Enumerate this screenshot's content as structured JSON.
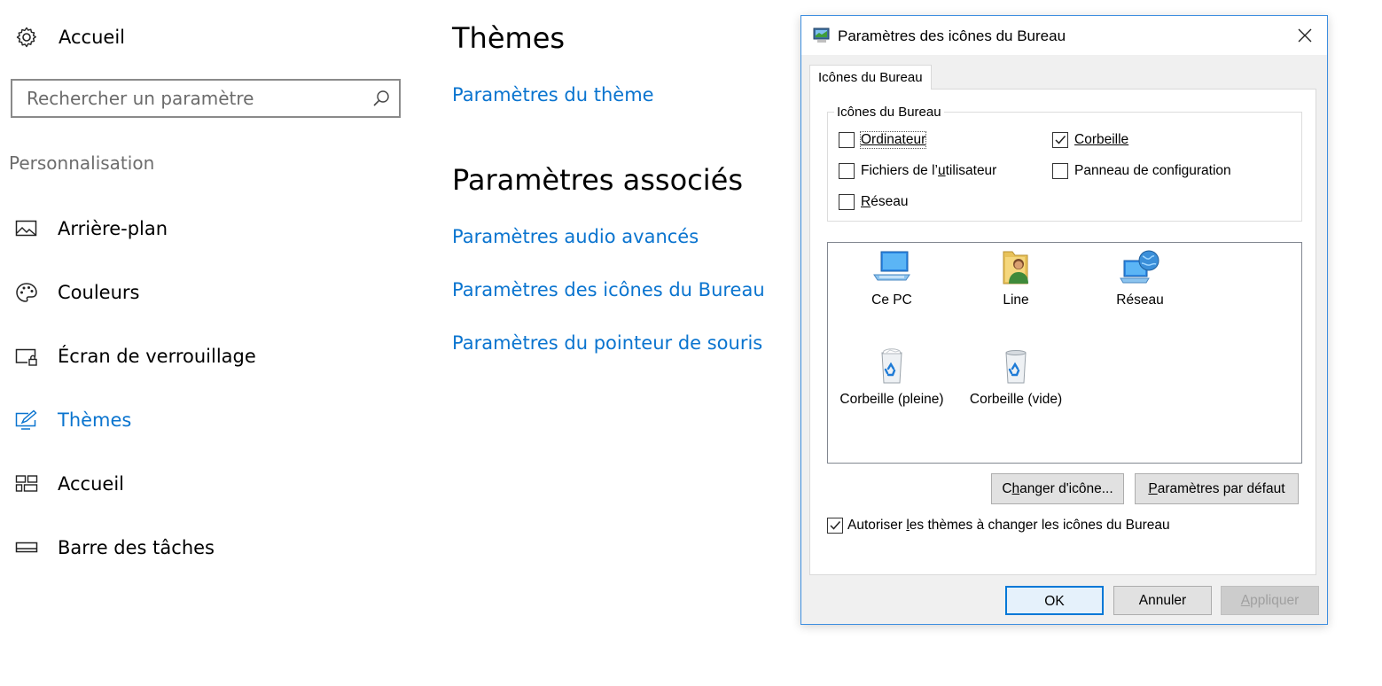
{
  "sidebar": {
    "home_label": "Accueil",
    "search_placeholder": "Rechercher un paramètre",
    "section": "Personnalisation",
    "items": [
      {
        "label": "Arrière-plan"
      },
      {
        "label": "Couleurs"
      },
      {
        "label": "Écran de verrouillage"
      },
      {
        "label": "Thèmes",
        "active": true
      },
      {
        "label": "Accueil"
      },
      {
        "label": "Barre des tâches"
      }
    ]
  },
  "main": {
    "title": "Thèmes",
    "theme_settings_link": "Paramètres du thème",
    "related_title": "Paramètres associés",
    "related_links": [
      "Paramètres audio avancés",
      "Paramètres des icônes du Bureau",
      "Paramètres du pointeur de souris"
    ]
  },
  "dialog": {
    "title": "Paramètres des icônes du Bureau",
    "tab": "Icônes du Bureau",
    "group_title": "Icônes du Bureau",
    "checkboxes": {
      "ordinateur": {
        "label": "Ordinateur",
        "checked": false
      },
      "corbeille": {
        "label": "Corbeille",
        "checked": true
      },
      "fichiers_a": "Fichiers de l’",
      "fichiers_u": "u",
      "fichiers_b": "tilisateur",
      "fichiers_checked": false,
      "panneau": {
        "label": "Panneau de configuration",
        "checked": false
      },
      "reseau_u": "R",
      "reseau_b": "éseau",
      "reseau_checked": false
    },
    "icons": [
      {
        "caption": "Ce PC",
        "icon": "computer-icon"
      },
      {
        "caption": "Line",
        "icon": "user-folder-icon"
      },
      {
        "caption": "Réseau",
        "icon": "network-icon"
      },
      {
        "caption": "Corbeille (pleine)",
        "icon": "recycle-bin-full-icon"
      },
      {
        "caption": "Corbeille (vide)",
        "icon": "recycle-bin-empty-icon"
      }
    ],
    "change_icon_u": "h",
    "change_icon_a": "C",
    "change_icon_b": "anger d'icône...",
    "default_a": "",
    "default_u": "P",
    "default_b": "aramètres par défaut",
    "allow_a": "Autoriser ",
    "allow_u": "l",
    "allow_b": "es thèmes à changer les icônes du Bureau",
    "allow_checked": true,
    "ok": "OK",
    "cancel": "Annuler",
    "apply_u": "A",
    "apply_b": "ppliquer"
  },
  "colors": {
    "accent": "#0a74cf",
    "dialog_border": "#3d8ee0"
  }
}
